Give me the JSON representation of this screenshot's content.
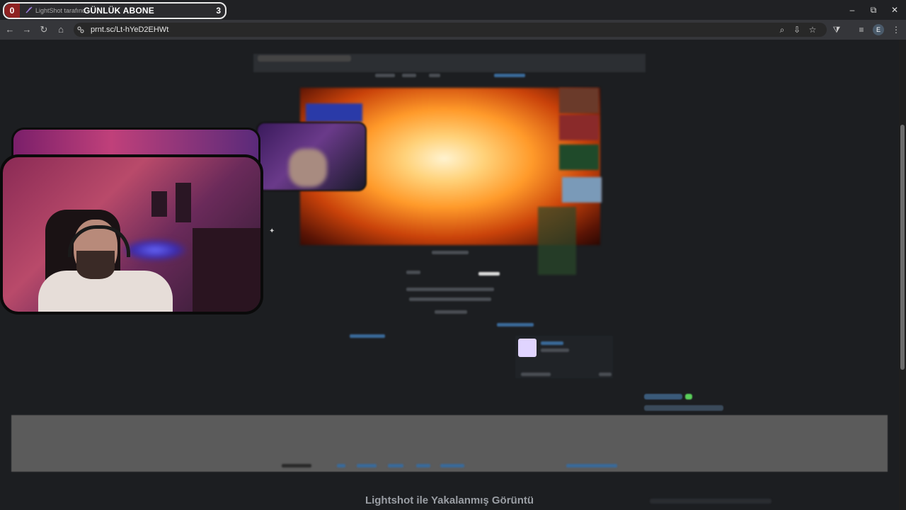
{
  "overlay": {
    "left_count": "0",
    "tab_title": "LightShot tarafından",
    "label": "GÜNLÜK ABONE",
    "right_count": "3"
  },
  "window_controls": {
    "minimize": "–",
    "maximize": "⧉",
    "close": "✕"
  },
  "toolbar": {
    "back": "←",
    "forward": "→",
    "reload": "↻",
    "home": "⌂",
    "url": "prnt.sc/Lt-hYeD2EHWt",
    "zoom_icon": "⌕",
    "install_icon": "⇩",
    "bookmark_icon": "☆",
    "extensions_icon": "⧩",
    "media_icon": "≡",
    "profile_initial": "E",
    "menu_icon": "⋮"
  },
  "page": {
    "caption": "Lightshot ile Yakalanmış Görüntü"
  },
  "colors": {
    "overlay_count_bg": "#8e2222",
    "browser_chrome": "#202124",
    "toolbar": "#35363a",
    "page_bg": "#1c1e21",
    "gray_band": "#5b5b5b"
  }
}
